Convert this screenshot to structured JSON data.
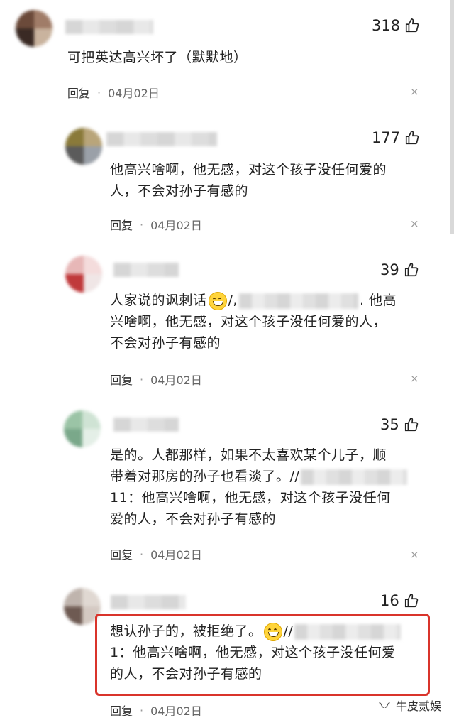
{
  "comments": [
    {
      "likes": "318",
      "text": "可把英达高兴坏了（默默地）",
      "reply": "回复",
      "sep": "·",
      "date": "04月02日",
      "close": "×"
    },
    {
      "likes": "177",
      "line1": "他高兴啥啊，他无感，对这个孩子没任何爱的",
      "line2": "人，不会对孙子有感的",
      "reply": "回复",
      "sep": "·",
      "date": "04月02日",
      "close": "×"
    },
    {
      "likes": "39",
      "l1a": "人家说的讽刺话",
      "l1b": "/,",
      "l1c": ". 他高",
      "line2": "兴啥啊，他无感，对这个孩子没任何爱的人，",
      "line3": "不会对孙子有感的",
      "reply": "回复",
      "sep": "·",
      "date": "04月02日",
      "close": "×"
    },
    {
      "likes": "35",
      "line1": "是的。人都那样，如果不太喜欢某个儿子，顺",
      "l2a": "带着对那房的孙子也看淡了。//",
      "line3": "11：他高兴啥啊，他无感，对这个孩子没任何",
      "line4": "爱的人，不会对孙子有感的",
      "reply": "回复",
      "sep": "·",
      "date": "04月02日",
      "close": "×"
    },
    {
      "likes": "16",
      "l1a": "想认孙子的，被拒绝了。",
      "l1b": "//",
      "line2": "1：他高兴啥啊，他无感，对这个孩子没任何爱",
      "line3": "的人，不会对孙子有感的",
      "reply": "回复",
      "sep": "·",
      "date": "04月02日"
    }
  ],
  "watermark": {
    "text": "牛皮贰娱",
    "icon": "wechat-channel-icon"
  },
  "colors": {
    "highlight": "#d9342b",
    "text": "#222222",
    "meta": "#666666"
  }
}
